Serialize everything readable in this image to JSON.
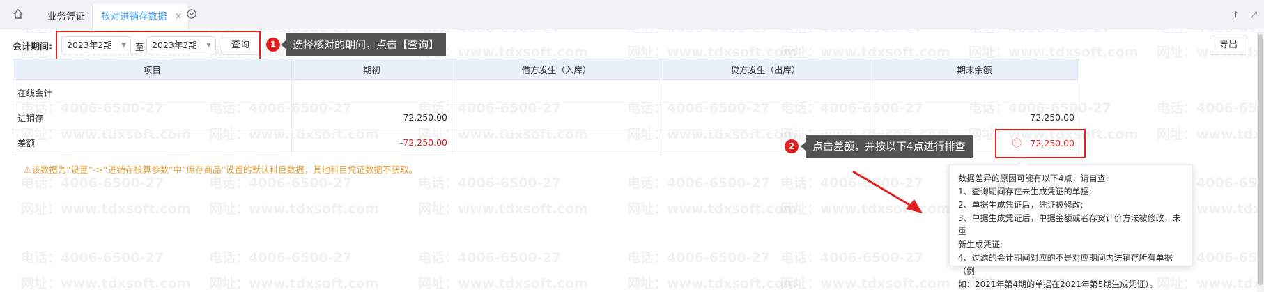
{
  "tabs": [
    {
      "label": "业务凭证",
      "active": false
    },
    {
      "label": "核对进销存数据",
      "active": true
    }
  ],
  "filter": {
    "label": "会计期间:",
    "from": "2023年2期",
    "to_text": "至",
    "to": "2023年2期",
    "query_label": "查询",
    "export_label": "导出"
  },
  "annotations": {
    "step1_number": "1",
    "step1_text": "选择核对的期间，点击【查询】",
    "step2_number": "2",
    "step2_text": "点击差额，并按以下4点进行排查"
  },
  "table": {
    "headers": [
      "项目",
      "期初",
      "借方发生（入库）",
      "贷方发生（出库）",
      "期末余额"
    ],
    "rows": [
      {
        "item": "在线会计",
        "opening": "",
        "debit": "",
        "credit": "",
        "ending": ""
      },
      {
        "item": "进销存",
        "opening": "72,250.00",
        "debit": "",
        "credit": "",
        "ending": "72,250.00"
      },
      {
        "item": "差额",
        "opening": "-72,250.00",
        "debit": "",
        "credit": "",
        "ending": "-72,250.00"
      }
    ]
  },
  "note": "⚠该数据为“设置”->“进销存核算参数”中“库存商品”设置的默认科目数据，其他科目凭证数据不获取。",
  "popover": {
    "lines": [
      "数据差异的原因可能有以下4点，请自查:",
      "1、查询期间存在未生成凭证的单据;",
      "2、单据生成凭证后，凭证被修改;",
      "3、单据生成凭证后，单据金额或者存货计价方法被修改，未重",
      "新生成凭证;",
      "4、过滤的会计期间对应的不是对应期间内进销存所有单据（例",
      "如：2021年第4期的单据在2021年第5期生成凭证）。"
    ]
  },
  "watermark": {
    "phone": "电话：4006-6500-27",
    "site": "网址：www.tdxsoft.com"
  },
  "colors": {
    "accent": "#409eff",
    "negative": "#e02020",
    "warning": "#e6a23c",
    "header_bg": "#eaf1fb",
    "callout_bg": "#545454"
  },
  "icons": [
    "home-icon",
    "close-icon",
    "more-icon",
    "warning-icon",
    "arrow-icon"
  ]
}
